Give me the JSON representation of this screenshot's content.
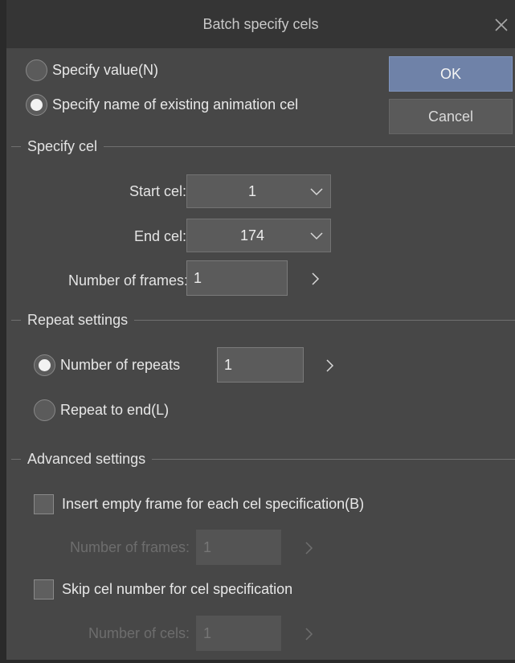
{
  "window": {
    "title": "Batch specify cels"
  },
  "buttons": {
    "ok": "OK",
    "cancel": "Cancel"
  },
  "mode": {
    "specify_value": "Specify value(N)",
    "specify_name": "Specify name of existing animation cel",
    "selected": "specify_name"
  },
  "specify_cel": {
    "title": "Specify cel",
    "start_label": "Start cel:",
    "start_value": "1",
    "end_label": "End cel:",
    "end_value": "174",
    "frames_label": "Number of frames:",
    "frames_value": "1"
  },
  "repeat": {
    "title": "Repeat settings",
    "repeats_label": "Number of repeats",
    "repeats_value": "1",
    "to_end_label": "Repeat to end(L)",
    "selected": "number_of_repeats"
  },
  "advanced": {
    "title": "Advanced settings",
    "insert_empty_label": "Insert empty frame for each cel specification(B)",
    "insert_empty_checked": false,
    "empty_frames_label": "Number of frames:",
    "empty_frames_value": "1",
    "skip_label": "Skip cel number for cel specification",
    "skip_checked": false,
    "cells_label": "Number of cels:",
    "cells_value": "1"
  },
  "icons": {
    "close": "close-icon",
    "dropdown": "chevron-down-icon",
    "next": "chevron-right-icon"
  }
}
